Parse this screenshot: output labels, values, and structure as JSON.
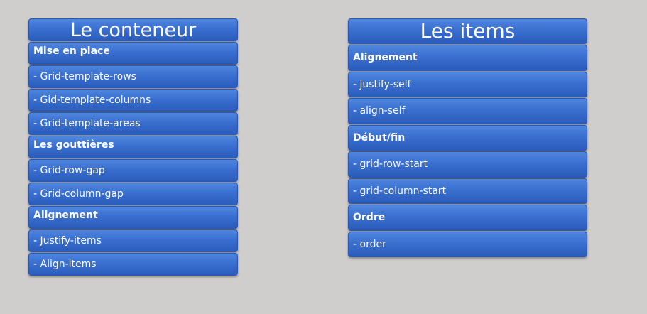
{
  "left": {
    "title": "Le conteneur",
    "rows": [
      {
        "kind": "section",
        "label": "Mise en place"
      },
      {
        "kind": "item",
        "label": "- Grid-template-rows"
      },
      {
        "kind": "item",
        "label": "- Gid-template-columns"
      },
      {
        "kind": "item",
        "label": "- Grid-template-areas"
      },
      {
        "kind": "section",
        "label": "Les gouttières"
      },
      {
        "kind": "item",
        "label": "- Grid-row-gap"
      },
      {
        "kind": "item",
        "label": "- Grid-column-gap"
      },
      {
        "kind": "section",
        "label": "Alignement"
      },
      {
        "kind": "item",
        "label": "- Justify-items"
      },
      {
        "kind": "item",
        "label": "- Align-items"
      }
    ]
  },
  "right": {
    "title": "Les items",
    "rows": [
      {
        "kind": "section",
        "label": "Alignement"
      },
      {
        "kind": "item",
        "label": "- justify-self"
      },
      {
        "kind": "item",
        "label": "- align-self"
      },
      {
        "kind": "section",
        "label": "Début/fin"
      },
      {
        "kind": "item",
        "label": "- grid-row-start"
      },
      {
        "kind": "item",
        "label": "- grid-column-start"
      },
      {
        "kind": "section",
        "label": "Ordre"
      },
      {
        "kind": "item",
        "label": "- order"
      }
    ]
  },
  "colors": {
    "background": "#d0cdcd",
    "box_top": "#4f86de",
    "box_bottom": "#2b5cbb",
    "text": "#ffffff"
  }
}
